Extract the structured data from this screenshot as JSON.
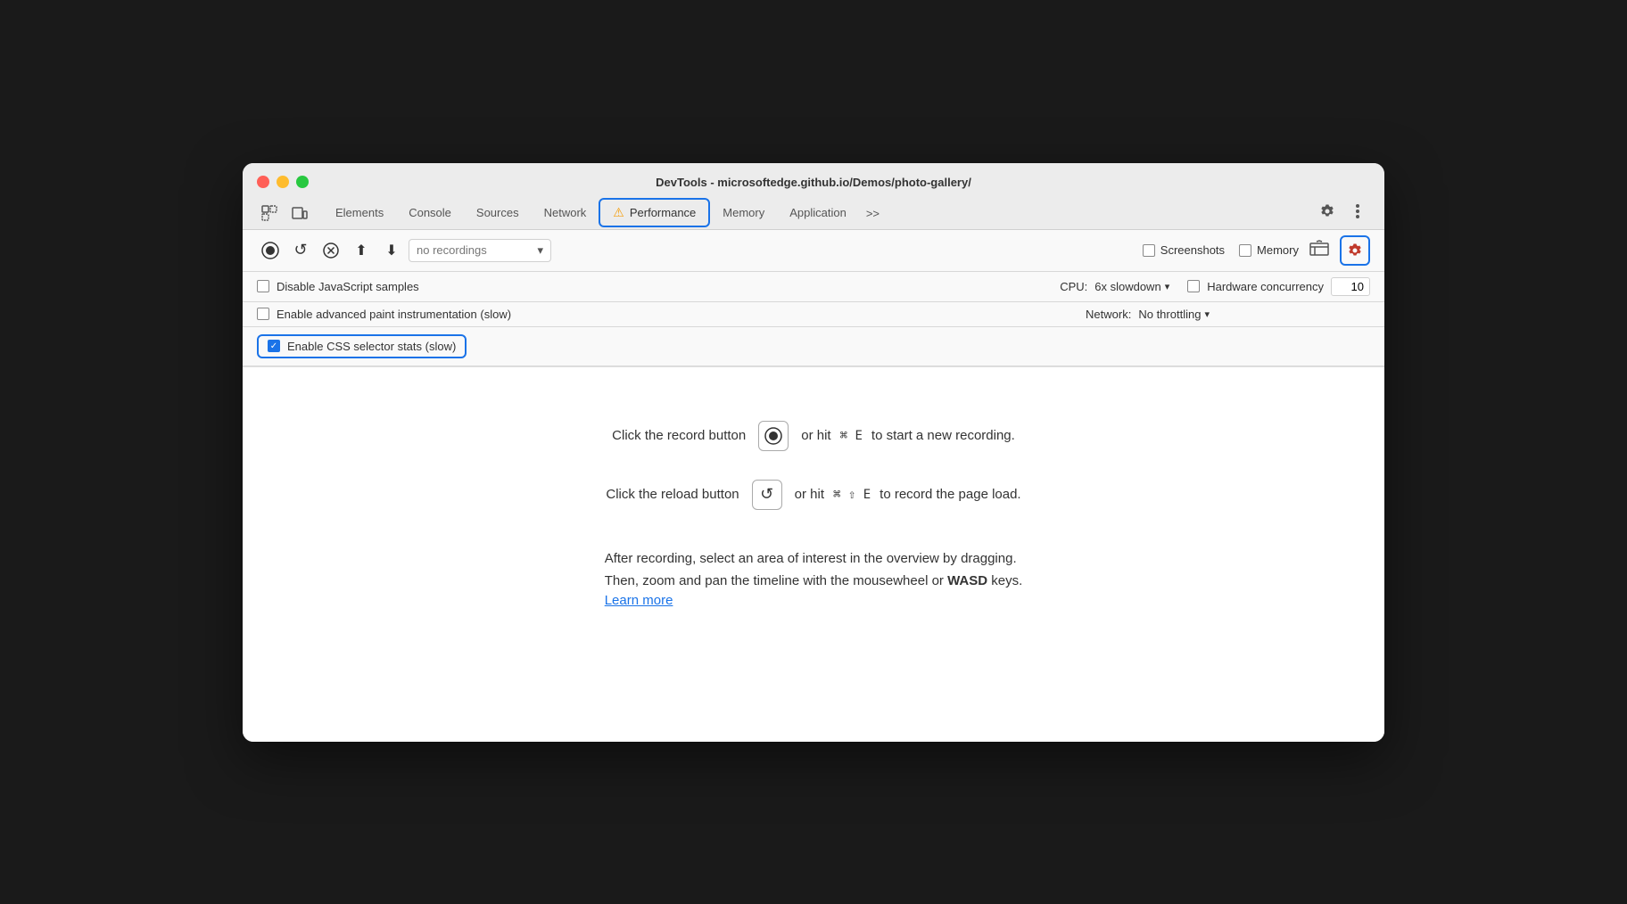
{
  "window": {
    "title": "DevTools - microsoftedge.github.io/Demos/photo-gallery/"
  },
  "tabs": {
    "items": [
      {
        "id": "elements",
        "label": "Elements",
        "active": false
      },
      {
        "id": "console",
        "label": "Console",
        "active": false
      },
      {
        "id": "sources",
        "label": "Sources",
        "active": false
      },
      {
        "id": "network",
        "label": "Network",
        "active": false
      },
      {
        "id": "performance",
        "label": "Performance",
        "active": true
      },
      {
        "id": "memory",
        "label": "Memory",
        "active": false
      },
      {
        "id": "application",
        "label": "Application",
        "active": false
      },
      {
        "id": "more",
        "label": ">>",
        "active": false
      }
    ]
  },
  "toolbar": {
    "recording_placeholder": "no recordings",
    "screenshots_label": "Screenshots",
    "memory_label": "Memory"
  },
  "options": {
    "disable_js_samples": "Disable JavaScript samples",
    "enable_paint": "Enable advanced paint instrumentation (slow)",
    "enable_css_stats": "Enable CSS selector stats (slow)",
    "cpu_label": "CPU:",
    "cpu_value": "6x slowdown",
    "network_label": "Network:",
    "network_value": "No throttling",
    "hardware_label": "Hardware concurrency",
    "hardware_value": "10"
  },
  "instructions": {
    "line1_pre": "Click the record button",
    "line1_record_icon": "⊙",
    "line1_mid": "or hit",
    "line1_shortcut": "⌘ E",
    "line1_post": "to start a new recording.",
    "line2_pre": "Click the reload button",
    "line2_reload_icon": "↺",
    "line2_mid": "or hit",
    "line2_shortcut": "⌘ ⇧ E",
    "line2_post": "to record the page load.",
    "line3": "After recording, select an area of interest in the overview by dragging.",
    "line4_pre": "Then, zoom and pan the timeline with the mousewheel or",
    "line4_bold": "WASD",
    "line4_post": "keys.",
    "learn_more": "Learn more"
  },
  "colors": {
    "blue": "#1a73e8",
    "red": "#c0392b",
    "orange": "#f59e0b",
    "checked": "#1a73e8"
  }
}
